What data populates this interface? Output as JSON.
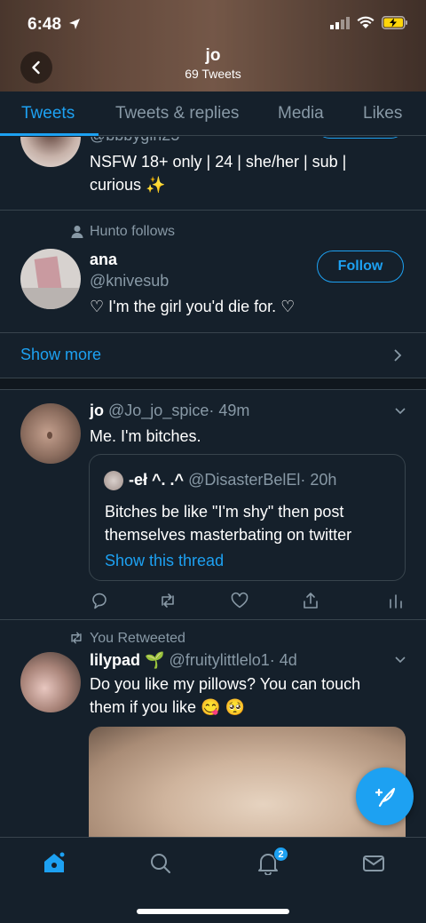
{
  "status_bar": {
    "time": "6:48"
  },
  "header": {
    "name": "jo",
    "tweet_count": "69 Tweets"
  },
  "tabs": [
    {
      "label": "Tweets"
    },
    {
      "label": "Tweets & replies"
    },
    {
      "label": "Media"
    },
    {
      "label": "Likes"
    }
  ],
  "follow_suggestions": [
    {
      "handle_partial": "@bbbygirl25",
      "bio": "NSFW 18+ only | 24 | she/her | sub | curious ✨"
    },
    {
      "context": "Hunto follows",
      "name": "ana",
      "handle": "@knivesub",
      "bio": "♡ I'm the girl you'd die for. ♡",
      "follow_label": "Follow"
    }
  ],
  "show_more": {
    "label": "Show more"
  },
  "tweets": [
    {
      "name": "jo",
      "handle": "@Jo_jo_spice",
      "time": "· 49m",
      "text": "Me. I'm bitches.",
      "quote": {
        "name": "-eł ^. .^",
        "handle": "@DisasterBelEl",
        "time": "· 20h",
        "text_line1": "Bitches be like \"I'm shy\" then post",
        "text_line2": "themselves masterbating on twitter",
        "thread_link": "Show this thread"
      }
    },
    {
      "context": "You Retweeted",
      "name": "lilypad",
      "name_emoji": "🌱",
      "handle": "@fruitylittlelo1",
      "time": "· 4d",
      "text_line1": "Do you like my pillows? You can touch",
      "text_line2": "them if you like 😋 🥺"
    }
  ],
  "nav": {
    "notifications_badge": "2"
  },
  "colors": {
    "background": "#15202b",
    "accent": "#1da1f2",
    "secondary_text": "#8899a6",
    "divider": "#38444d"
  }
}
